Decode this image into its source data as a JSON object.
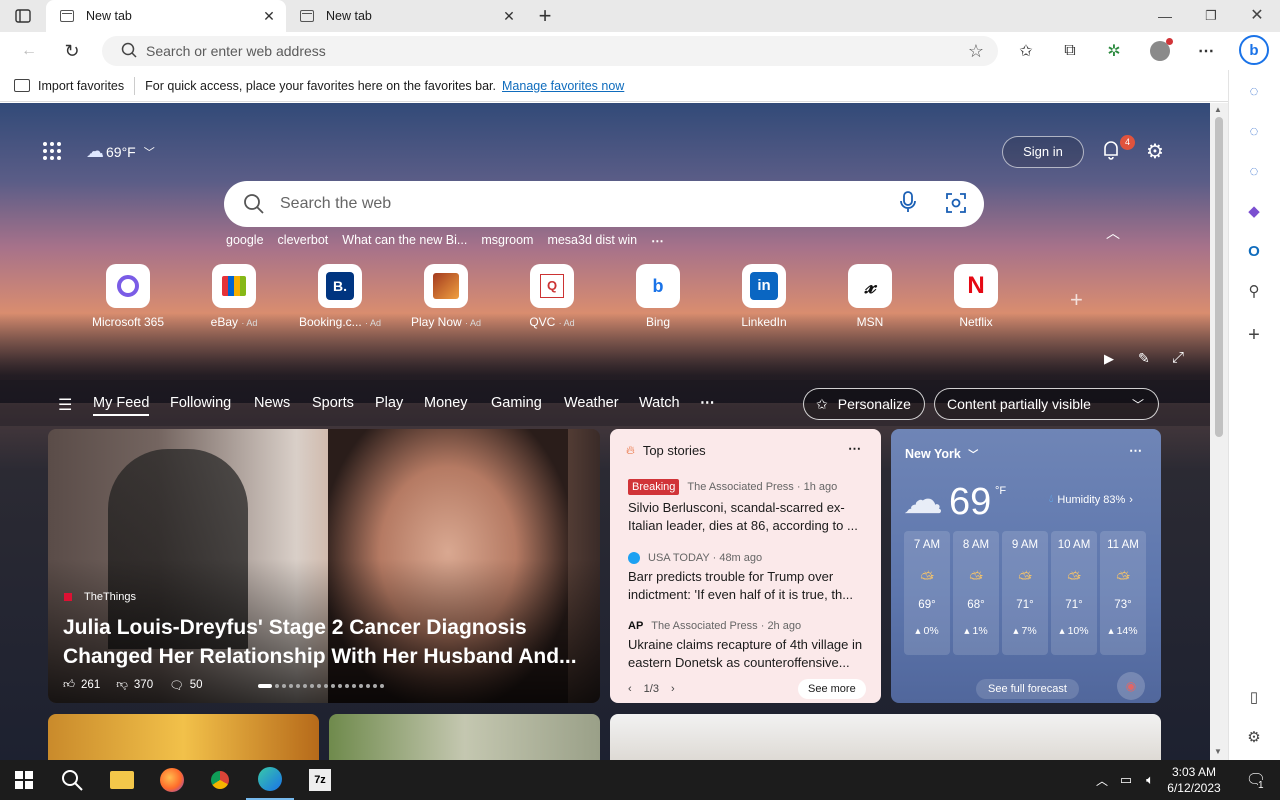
{
  "browser": {
    "tabs": [
      {
        "label": "New tab",
        "active": true
      },
      {
        "label": "New tab",
        "active": false
      }
    ],
    "address_placeholder": "Search or enter web address",
    "favbar": {
      "import_label": "Import favorites",
      "message": "For quick access, place your favorites here on the favorites bar.",
      "manage_link": "Manage favorites now"
    }
  },
  "newtab": {
    "weather_temp": "69°F",
    "signin_label": "Sign in",
    "notification_count": "4",
    "search_placeholder": "Search the web",
    "trending": [
      "google",
      "cleverbot",
      "What can the new Bi...",
      "msgroom",
      "mesa3d dist win"
    ],
    "quick_links": [
      {
        "label": "Microsoft 365",
        "ad": ""
      },
      {
        "label": "eBay",
        "ad": "· Ad"
      },
      {
        "label": "Booking.c...",
        "ad": "· Ad"
      },
      {
        "label": "Play Now",
        "ad": "· Ad"
      },
      {
        "label": "QVC",
        "ad": "· Ad"
      },
      {
        "label": "Bing",
        "ad": ""
      },
      {
        "label": "LinkedIn",
        "ad": ""
      },
      {
        "label": "MSN",
        "ad": ""
      },
      {
        "label": "Netflix",
        "ad": ""
      }
    ],
    "feed_nav": [
      "My Feed",
      "Following",
      "News",
      "Sports",
      "Play",
      "Money",
      "Gaming",
      "Weather",
      "Watch"
    ],
    "personalize_label": "Personalize",
    "content_visibility": "Content partially visible"
  },
  "hero": {
    "source": "TheThings",
    "headline_line1": "Julia Louis-Dreyfus' Stage 2 Cancer Diagnosis",
    "headline_line2": "Changed Her Relationship With Her Husband And...",
    "likes": "261",
    "dislikes": "370",
    "comments": "50"
  },
  "top_stories": {
    "title": "Top stories",
    "stories": [
      {
        "badge": "Breaking",
        "source": "The Associated Press · 1h ago",
        "headline": "Silvio Berlusconi, scandal-scarred ex-Italian leader, dies at 86, according to ..."
      },
      {
        "badge": "",
        "source": "USA TODAY · 48m ago",
        "headline": "Barr predicts trouble for Trump over indictment: 'If even half of it is true, th..."
      },
      {
        "badge": "",
        "source": "The Associated Press · 2h ago",
        "headline": "Ukraine claims recapture of 4th village in eastern Donetsk as counteroffensive..."
      }
    ],
    "pager": "1/3",
    "see_more": "See more"
  },
  "weather": {
    "city": "New York",
    "temp": "69",
    "unit": "°F",
    "humidity": "Humidity 83%",
    "hourly": [
      {
        "time": "7 AM",
        "temp": "69°",
        "precip": "0%"
      },
      {
        "time": "8 AM",
        "temp": "68°",
        "precip": "1%"
      },
      {
        "time": "9 AM",
        "temp": "71°",
        "precip": "7%"
      },
      {
        "time": "10 AM",
        "temp": "71°",
        "precip": "10%"
      },
      {
        "time": "11 AM",
        "temp": "73°",
        "precip": "14%"
      }
    ],
    "forecast_link": "See full forecast"
  },
  "taskbar": {
    "time": "3:03 AM",
    "date": "6/12/2023",
    "notifications": "1"
  }
}
